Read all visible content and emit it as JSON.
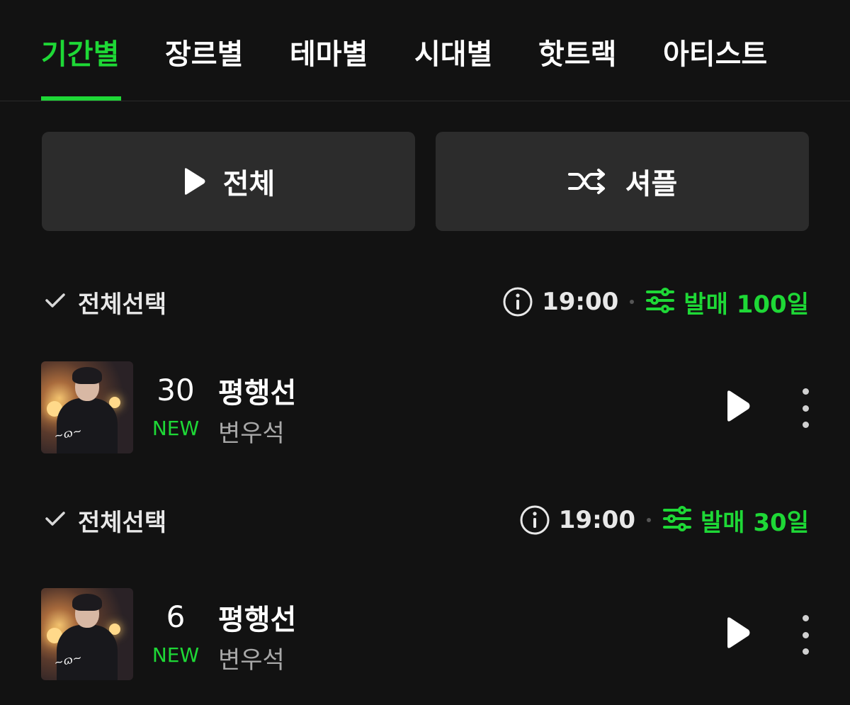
{
  "tabs": [
    {
      "label": "기간별",
      "active": true
    },
    {
      "label": "장르별",
      "active": false
    },
    {
      "label": "테마별",
      "active": false
    },
    {
      "label": "시대별",
      "active": false
    },
    {
      "label": "핫트랙",
      "active": false
    },
    {
      "label": "아티스트",
      "active": false
    }
  ],
  "actions": {
    "play_all_label": "전체",
    "shuffle_label": "셔플",
    "play_icon": "play-icon",
    "shuffle_icon": "shuffle-icon"
  },
  "sections": [
    {
      "select_all_label": "전체선택",
      "time": "19:00",
      "filter_label": "발매 100일",
      "tracks": [
        {
          "rank": "30",
          "badge": "NEW",
          "title": "평행선",
          "artist": "변우석"
        }
      ]
    },
    {
      "select_all_label": "전체선택",
      "time": "19:00",
      "filter_label": "발매 30일",
      "tracks": [
        {
          "rank": "6",
          "badge": "NEW",
          "title": "평행선",
          "artist": "변우석"
        }
      ]
    }
  ],
  "colors": {
    "accent": "#1ed836",
    "background": "#121212",
    "button_bg": "#2c2c2c",
    "secondary_text": "#a8a8a8"
  }
}
